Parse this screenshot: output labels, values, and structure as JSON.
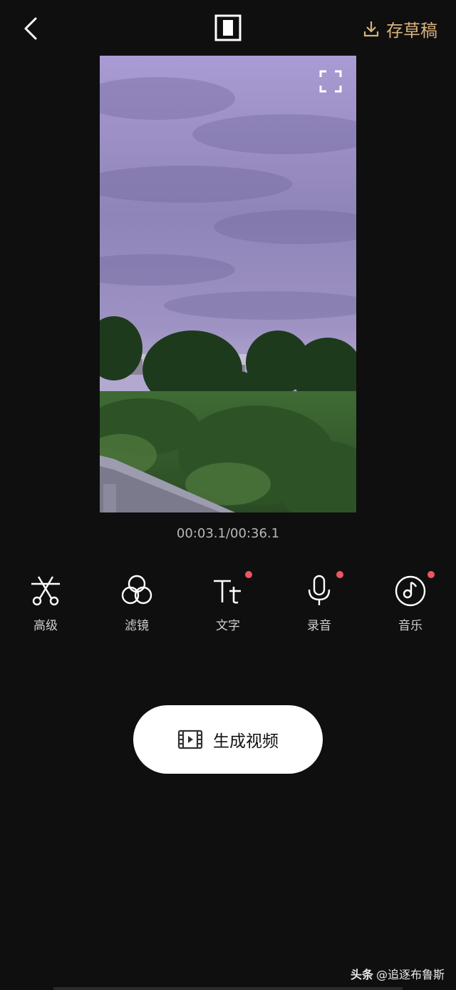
{
  "header": {
    "back_icon": "chevron-left-icon",
    "ratio_icon": "aspect-ratio-icon",
    "draft_icon": "download-tray-icon",
    "draft_label": "存草稿",
    "accent_color": "#d9b27c"
  },
  "preview": {
    "fullscreen_icon": "fullscreen-corners-icon",
    "timecode": "00:03.1/00:36.1"
  },
  "tools": [
    {
      "label": "高级",
      "icon": "scissors-icon",
      "badge": false
    },
    {
      "label": "滤镜",
      "icon": "filter-circles-icon",
      "badge": false
    },
    {
      "label": "文字",
      "icon": "text-tt-icon",
      "badge": true
    },
    {
      "label": "录音",
      "icon": "microphone-icon",
      "badge": true
    },
    {
      "label": "音乐",
      "icon": "music-note-icon",
      "badge": true
    }
  ],
  "generate": {
    "label": "生成视频",
    "icon": "film-play-icon"
  },
  "watermark": {
    "brand": "头条",
    "handle": "@追逐布鲁斯"
  },
  "badge_color": "#f0555f"
}
